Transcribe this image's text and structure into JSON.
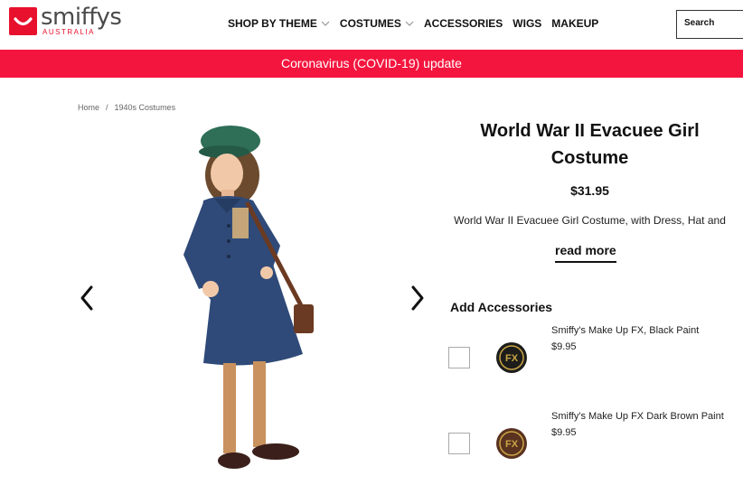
{
  "brand": {
    "name": "smiffys",
    "region": "AUSTRALIA",
    "accent": "#e8112d"
  },
  "nav": [
    {
      "label": "SHOP BY THEME",
      "has_dropdown": true
    },
    {
      "label": "COSTUMES",
      "has_dropdown": true
    },
    {
      "label": "ACCESSORIES",
      "has_dropdown": false
    },
    {
      "label": "WIGS",
      "has_dropdown": false
    },
    {
      "label": "MAKEUP",
      "has_dropdown": false
    }
  ],
  "search": {
    "placeholder": "Search"
  },
  "banner": {
    "text": "Coronavirus (COVID-19) update",
    "color": "#f4153e"
  },
  "breadcrumb": {
    "home": "Home",
    "separator": "/",
    "current": "1940s Costumes"
  },
  "product": {
    "title": "World War II Evacuee Girl Costume",
    "price": "$31.95",
    "description": "World War II Evacuee Girl Costume, with Dress, Hat and",
    "read_more": "read more"
  },
  "accessories": {
    "heading": "Add Accessories",
    "items": [
      {
        "name": "Smiffy's Make Up FX, Black Paint",
        "price": "$9.95",
        "swatch": "#1d1d1b"
      },
      {
        "name": "Smiffy's Make Up FX Dark Brown Paint",
        "price": "$9.95",
        "swatch": "#5a3220"
      }
    ]
  },
  "icons": {
    "prev": "chevron-left-icon",
    "next": "chevron-right-icon",
    "dropdown": "chevron-down-icon"
  }
}
